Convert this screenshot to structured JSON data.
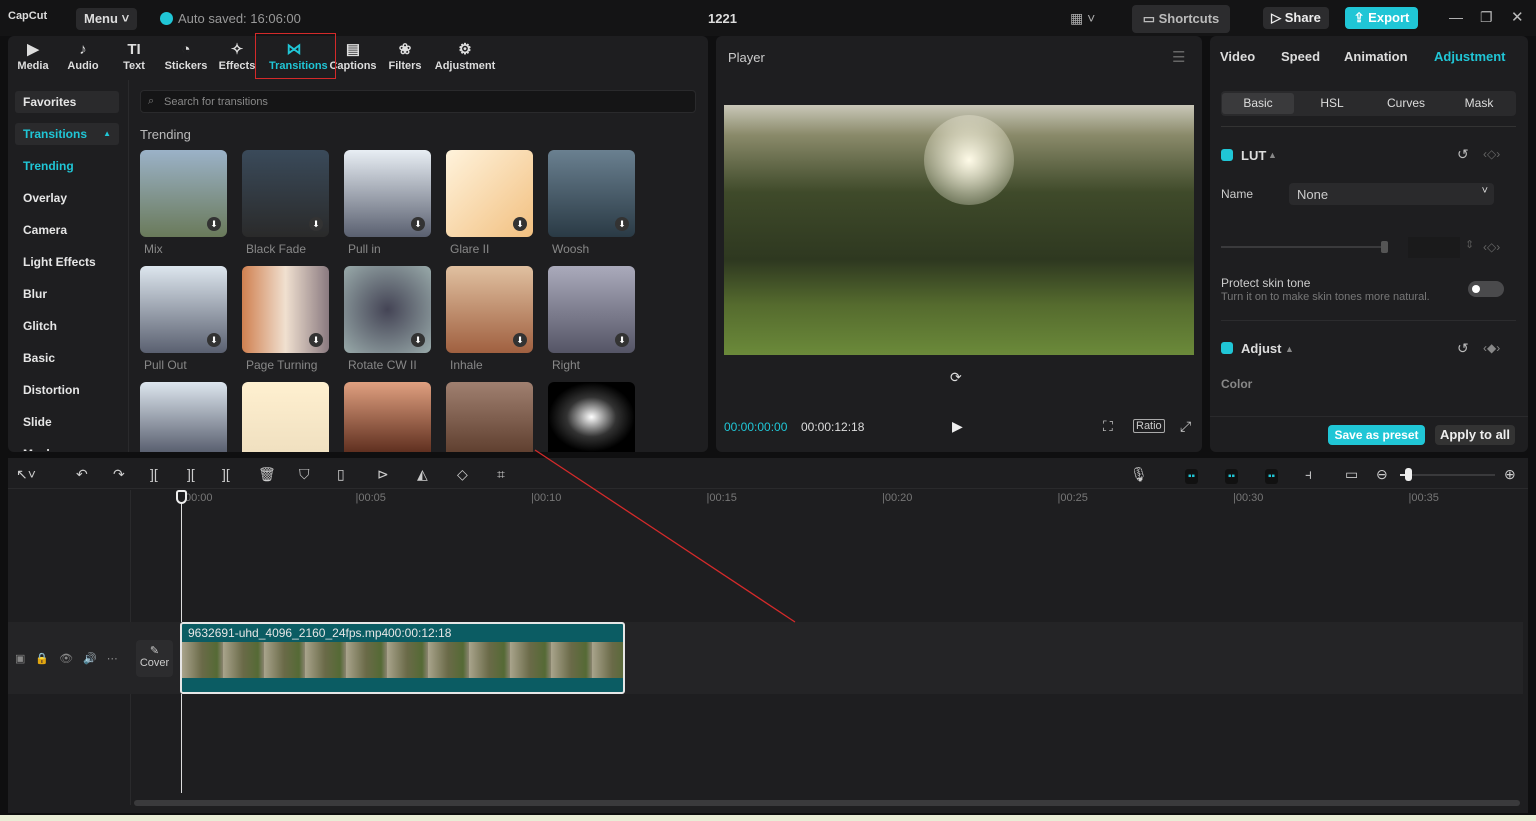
{
  "app": {
    "logo": "CapCut",
    "menu": "Menu",
    "autosave": "Auto saved: 16:06:00",
    "project": "1221",
    "shortcuts": "Shortcuts",
    "share": "Share",
    "export": "Export"
  },
  "toolbar": [
    {
      "label": "Media",
      "icon": "▶"
    },
    {
      "label": "Audio",
      "icon": "♪"
    },
    {
      "label": "Text",
      "icon": "TI"
    },
    {
      "label": "Stickers",
      "icon": "◔"
    },
    {
      "label": "Effects",
      "icon": "✧"
    },
    {
      "label": "Transitions",
      "icon": "⋈",
      "active": true
    },
    {
      "label": "Captions",
      "icon": "▤"
    },
    {
      "label": "Filters",
      "icon": "❀"
    },
    {
      "label": "Adjustment",
      "icon": "⚙"
    }
  ],
  "sidebar": {
    "items": [
      "Favorites",
      "Transitions",
      "Trending",
      "Overlay",
      "Camera",
      "Light Effects",
      "Blur",
      "Glitch",
      "Basic",
      "Distortion",
      "Slide",
      "Mask"
    ]
  },
  "search": {
    "placeholder": "Search for transitions"
  },
  "section": "Trending",
  "transitions": [
    "Mix",
    "Black Fade",
    "Pull in",
    "Glare II",
    "Woosh",
    "Pull Out",
    "Page Turning",
    "Rotate CW II",
    "Inhale",
    "Right",
    "",
    "",
    "",
    "",
    ""
  ],
  "player": {
    "title": "Player",
    "current": "00:00:00:00",
    "total": "00:00:12:18",
    "ratio": "Ratio"
  },
  "right": {
    "tabs": [
      "Video",
      "Speed",
      "Animation",
      "Adjustment"
    ],
    "active_tab": "Adjustment",
    "subtabs": [
      "Basic",
      "HSL",
      "Curves",
      "Mask"
    ],
    "lut": "LUT",
    "name_label": "Name",
    "name_value": "None",
    "protect": "Protect skin tone",
    "protect_hint": "Turn it on to make skin tones more natural.",
    "protect_on": false,
    "adjust": "Adjust",
    "color": "Color",
    "save_preset": "Save as preset",
    "apply_all": "Apply to all"
  },
  "timeline": {
    "ticks": [
      "00:00",
      "00:05",
      "00:10",
      "00:15",
      "00:20",
      "00:25",
      "00:30",
      "00:35"
    ],
    "clip_name": "9632691-uhd_4096_2160_24fps.mp4",
    "clip_duration": "00:00:12:18",
    "cover": "Cover",
    "zoom_level": 0.08
  },
  "colors": {
    "accent": "#20c6d6",
    "clip": "#0b5c63",
    "annotation": "#d42a2a"
  }
}
